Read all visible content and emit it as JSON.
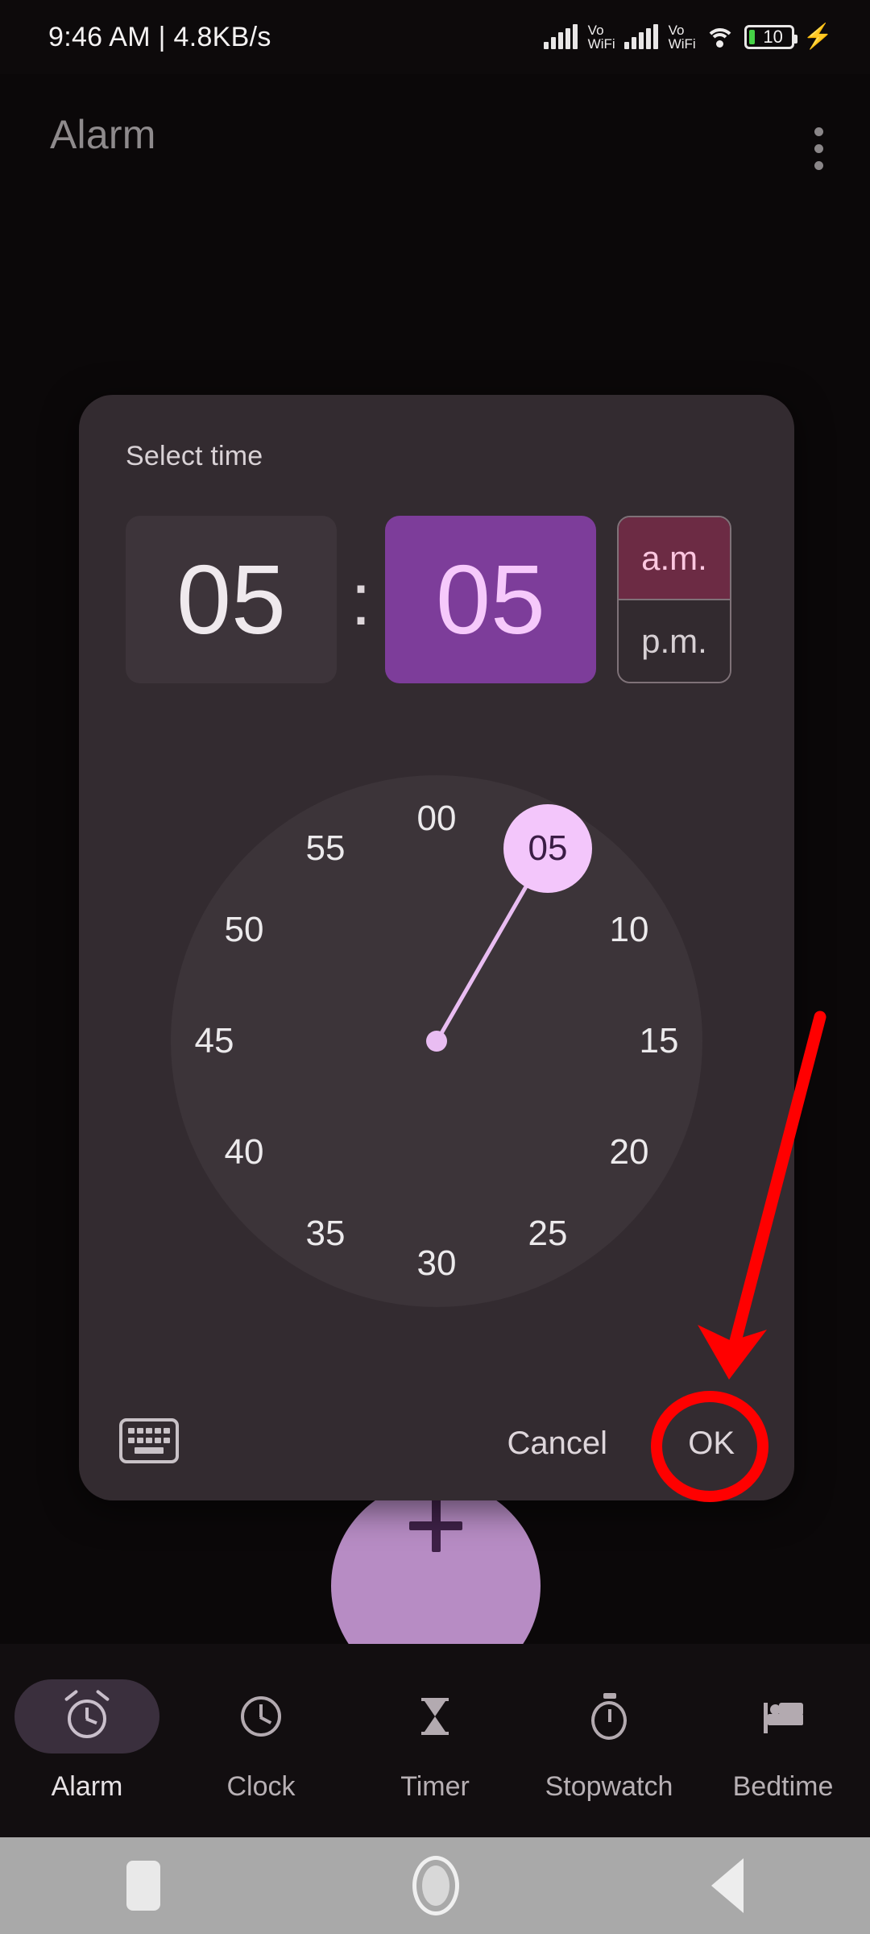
{
  "status_bar": {
    "time": "9:46 AM",
    "separator": "|",
    "data_speed": "4.8KB/s",
    "network_label_1": "Vo",
    "network_label_2": "WiFi",
    "network2_label_1": "Vo",
    "network2_label_2": "WiFi",
    "battery_percent": "10",
    "charging_glyph": "⚡",
    "icons": [
      "signal-bars-icon",
      "volte-wifi-icon",
      "signal-bars-icon",
      "volte-wifi-icon",
      "wifi-icon",
      "battery-icon",
      "charging-bolt-icon"
    ]
  },
  "header": {
    "title": "Alarm",
    "overflow_menu": "more-options"
  },
  "fab": {
    "label": "+",
    "color": "#b78cc4"
  },
  "dialog": {
    "title": "Select time",
    "hour": "05",
    "colon": ":",
    "minute": "05",
    "am_label": "a.m.",
    "pm_label": "p.m.",
    "period_selected": "a.m.",
    "active_field": "minute",
    "keyboard_toggle": "keyboard-icon",
    "cancel_label": "Cancel",
    "ok_label": "OK",
    "colors": {
      "surface": "#332b30",
      "hour_bg": "#3d343a",
      "minute_bg": "#7d3d9a",
      "minute_fg": "#f6c9fb",
      "am_bg": "#6c2b44",
      "am_fg": "#fcc7e0",
      "accent": "#f3c6fb"
    }
  },
  "clock_dial": {
    "selected_value": "05",
    "selected_angle_deg": 30,
    "ticks": [
      {
        "label": "00",
        "angle": 0
      },
      {
        "label": "05",
        "angle": 30
      },
      {
        "label": "10",
        "angle": 60
      },
      {
        "label": "15",
        "angle": 90
      },
      {
        "label": "20",
        "angle": 120
      },
      {
        "label": "25",
        "angle": 150
      },
      {
        "label": "30",
        "angle": 180
      },
      {
        "label": "35",
        "angle": 210
      },
      {
        "label": "40",
        "angle": 240
      },
      {
        "label": "45",
        "angle": 270
      },
      {
        "label": "50",
        "angle": 300
      },
      {
        "label": "55",
        "angle": 330
      }
    ]
  },
  "annotation": {
    "arrow_color": "#ff0000",
    "target": "OK",
    "shapes": [
      "arrow-pointing-to-ok",
      "ellipse-around-ok"
    ]
  },
  "tabs": [
    {
      "label": "Alarm",
      "icon": "alarm-clock-icon",
      "active": true
    },
    {
      "label": "Clock",
      "icon": "clock-icon",
      "active": false
    },
    {
      "label": "Timer",
      "icon": "hourglass-icon",
      "active": false
    },
    {
      "label": "Stopwatch",
      "icon": "stopwatch-icon",
      "active": false
    },
    {
      "label": "Bedtime",
      "icon": "bed-icon",
      "active": false
    }
  ],
  "system_nav": {
    "recents": "square-recents-icon",
    "home": "circle-home-icon",
    "back": "triangle-back-icon"
  }
}
